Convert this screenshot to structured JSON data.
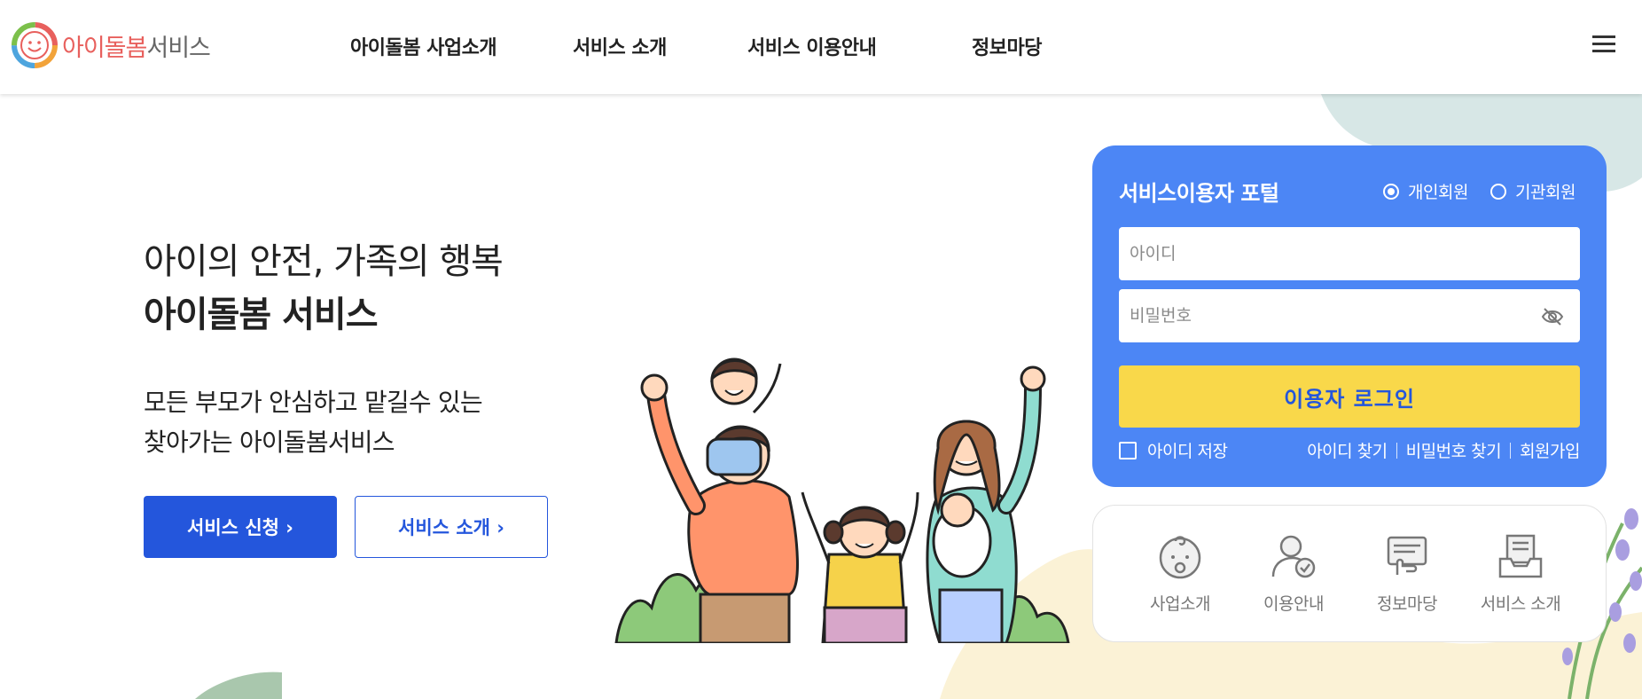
{
  "header": {
    "logo_text_a": "아이돌봄",
    "logo_text_b": "서비스",
    "nav": [
      {
        "label": "아이돌봄 사업소개"
      },
      {
        "label": "서비스 소개"
      },
      {
        "label": "서비스 이용안내"
      },
      {
        "label": "정보마당"
      }
    ]
  },
  "hero": {
    "line1": "아이의 안전, 가족의 행복",
    "line2": "아이돌봄 서비스",
    "desc1": "모든 부모가 안심하고 맡길수 있는",
    "desc2": "찾아가는 아이돌봄서비스",
    "apply_label": "서비스 신청 ›",
    "intro_label": "서비스 소개 ›"
  },
  "login": {
    "title": "서비스이용자 포털",
    "radio_personal": "개인회원",
    "radio_org": "기관회원",
    "selected": "개인회원",
    "id_placeholder": "아이디",
    "pw_placeholder": "비밀번호",
    "login_label": "이용자 로그인",
    "save_id": "아이디 저장",
    "find_id": "아이디 찾기",
    "find_pw": "비밀번호 찾기",
    "join": "회원가입"
  },
  "quick_menu": [
    {
      "label": "사업소개",
      "icon": "baby-icon"
    },
    {
      "label": "이용안내",
      "icon": "user-check-icon"
    },
    {
      "label": "정보마당",
      "icon": "hand-card-icon"
    },
    {
      "label": "서비스 소개",
      "icon": "inbox-document-icon"
    }
  ],
  "colors": {
    "primary": "#2456dc",
    "panel": "#4c86f5",
    "login_button": "#f9d84a",
    "logo_accent": "#e8605d"
  }
}
